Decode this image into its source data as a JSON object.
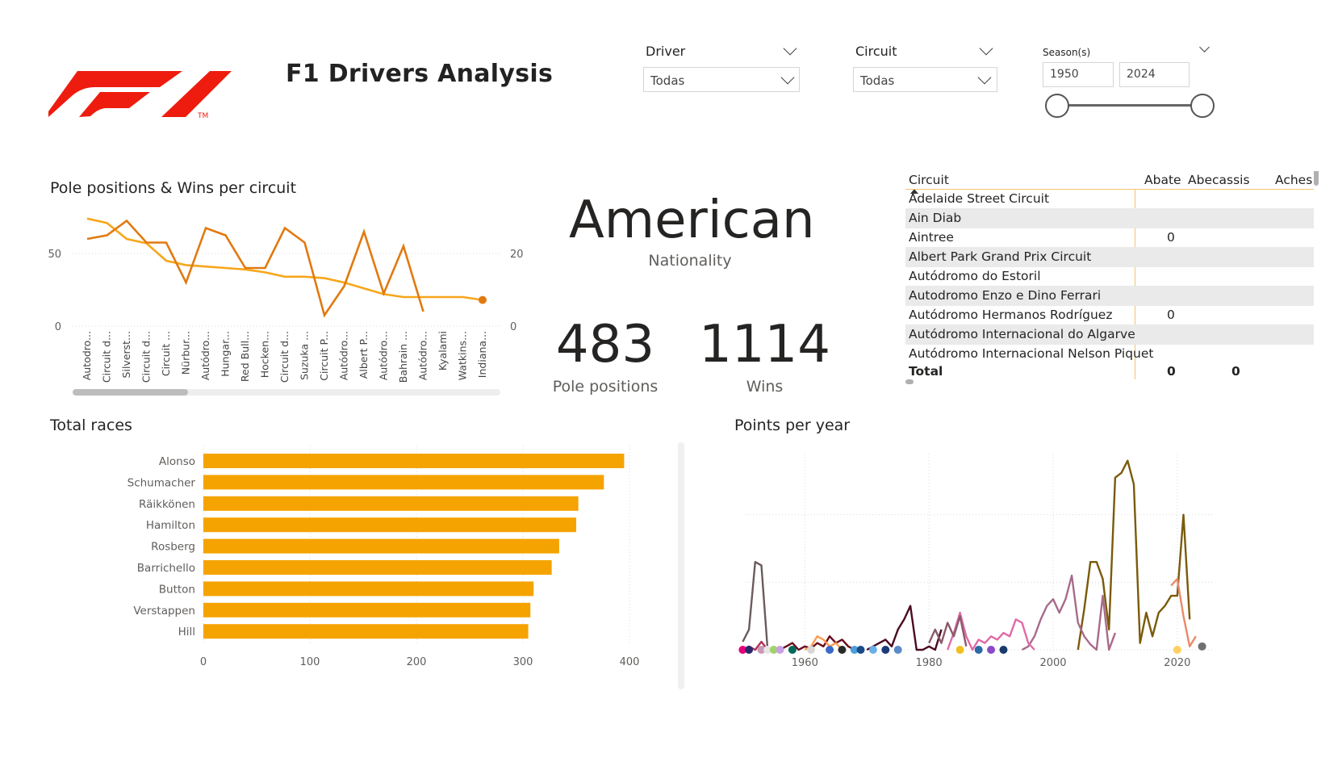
{
  "header": {
    "title": "F1 Drivers Analysis",
    "logo_mark": "F1",
    "logo_tm": "TM"
  },
  "slicers": {
    "driver": {
      "label": "Driver",
      "value": "Todas"
    },
    "circuit": {
      "label": "Circuit",
      "value": "Todas"
    },
    "season": {
      "label": "Season(s)",
      "from": "1950",
      "to": "2024",
      "range_fraction": [
        0,
        1
      ]
    }
  },
  "kpis": {
    "nationality": {
      "value": "American",
      "label": "Nationality"
    },
    "poles": {
      "value": "483",
      "label": "Pole positions"
    },
    "wins": {
      "value": "1114",
      "label": "Wins"
    }
  },
  "matrix": {
    "headers": [
      "Circuit",
      "Abate",
      "Abecassis",
      "Aches"
    ],
    "rows": [
      {
        "circuit": "Adelaide Street Circuit",
        "abate": "",
        "abecassis": ""
      },
      {
        "circuit": "Ain Diab",
        "abate": "",
        "abecassis": ""
      },
      {
        "circuit": "Aintree",
        "abate": "0",
        "abecassis": ""
      },
      {
        "circuit": "Albert Park Grand Prix Circuit",
        "abate": "",
        "abecassis": ""
      },
      {
        "circuit": "Autódromo do Estoril",
        "abate": "",
        "abecassis": ""
      },
      {
        "circuit": "Autodromo Enzo e Dino Ferrari",
        "abate": "",
        "abecassis": ""
      },
      {
        "circuit": "Autódromo Hermanos Rodríguez",
        "abate": "0",
        "abecassis": ""
      },
      {
        "circuit": "Autódromo Internacional do Algarve",
        "abate": "",
        "abecassis": ""
      },
      {
        "circuit": "Autódromo Internacional Nelson Piquet",
        "abate": "",
        "abecassis": ""
      }
    ],
    "total": {
      "label": "Total",
      "abate": "0",
      "abecassis": "0"
    }
  },
  "colors": {
    "accent": "#f5a300",
    "line_dark": "#e07a10",
    "line_light": "#f7a61a",
    "logo": "#ee1c0e",
    "grid": "#d9d9d9"
  },
  "chart_data": [
    {
      "type": "line",
      "title": "Pole positions & Wins per circuit",
      "categories": [
        "Autodro...",
        "Circuit d...",
        "Silverst...",
        "Circuit d...",
        "Circuit ...",
        "Nürbur...",
        "Autódro...",
        "Hungar...",
        "Red Bull...",
        "Hocken...",
        "Circuit d...",
        "Suzuka ...",
        "Circuit P...",
        "Autódro...",
        "Albert P...",
        "Autódro...",
        "Bahrain ...",
        "Autódro...",
        "Kyalami",
        "Watkins...",
        "Indiana..."
      ],
      "y_left": {
        "ticks": [
          "0",
          "50"
        ],
        "range": [
          0,
          100
        ]
      },
      "y_right": {
        "ticks": [
          "0",
          "20"
        ],
        "range": [
          0,
          42
        ]
      },
      "series": [
        {
          "axis": "left",
          "values": [
            74,
            71,
            60,
            57,
            45,
            42,
            41,
            40,
            39,
            37,
            34,
            34,
            33,
            30,
            26,
            22,
            20,
            20,
            20,
            20,
            18
          ]
        },
        {
          "axis": "right",
          "values": [
            24,
            25,
            29,
            23,
            23,
            12,
            27,
            25,
            16,
            16,
            27,
            23,
            3,
            11,
            26,
            9,
            22,
            4,
            null,
            null,
            null
          ]
        }
      ]
    },
    {
      "type": "bar",
      "title": "Total races",
      "categories": [
        "Alonso",
        "Schumacher",
        "Räikkönen",
        "Hamilton",
        "Rosberg",
        "Barrichello",
        "Button",
        "Verstappen",
        "Hill"
      ],
      "values": [
        395,
        376,
        352,
        350,
        334,
        327,
        310,
        307,
        305
      ],
      "x_ticks": [
        "0",
        "100",
        "200",
        "300",
        "400"
      ],
      "xlim": [
        0,
        400
      ]
    },
    {
      "type": "line",
      "title": "Points per year",
      "x_ticks": [
        "1960",
        "1980",
        "2000",
        "2020"
      ],
      "y_ticks": [
        "0",
        "100",
        "200",
        "300"
      ],
      "xlim": [
        1948,
        2026
      ],
      "ylim": [
        0,
        300
      ],
      "series": [
        {
          "color": "#6b5b5b",
          "x": [
            1950,
            1951,
            1952,
            1953,
            1954
          ],
          "y": [
            12,
            30,
            130,
            125,
            0
          ]
        },
        {
          "color": "#7a5a0a",
          "x": [
            2004,
            2005,
            2006,
            2007,
            2008,
            2009,
            2010,
            2011,
            2012,
            2013,
            2014,
            2015,
            2016,
            2017,
            2018,
            2019,
            2020,
            2021,
            2022,
            2023,
            2024
          ],
          "y": [
            0,
            60,
            130,
            130,
            105,
            30,
            255,
            262,
            280,
            245,
            10,
            55,
            20,
            55,
            65,
            80,
            80,
            200,
            45,
            null,
            null
          ]
        },
        {
          "color": "#a86a8a",
          "x": [
            1995,
            1996,
            1997,
            1998,
            1999,
            2000,
            2001,
            2002,
            2003,
            2004,
            2005,
            2006,
            2007,
            2008,
            2009,
            2010
          ],
          "y": [
            0,
            5,
            20,
            45,
            65,
            75,
            55,
            75,
            110,
            40,
            20,
            8,
            0,
            80,
            0,
            25
          ]
        },
        {
          "color": "#e06aa8",
          "x": [
            1983,
            1984,
            1985,
            1986,
            1987,
            1988,
            1989,
            1990,
            1991,
            1992,
            1993,
            1994,
            1995,
            1996,
            1997
          ],
          "y": [
            0,
            25,
            55,
            20,
            0,
            15,
            10,
            20,
            15,
            25,
            20,
            45,
            40,
            10,
            0
          ]
        },
        {
          "color": "#4a0a22",
          "x": [
            1970,
            1971,
            1972,
            1973,
            1974,
            1975,
            1976,
            1977,
            1978,
            1979,
            1980,
            1981,
            1982
          ],
          "y": [
            0,
            5,
            10,
            15,
            5,
            30,
            45,
            65,
            0,
            0,
            5,
            0,
            30
          ]
        },
        {
          "color": "#8a5a6a",
          "x": [
            1980,
            1981,
            1982,
            1983,
            1984,
            1985,
            1986
          ],
          "y": [
            10,
            30,
            10,
            40,
            20,
            50,
            5
          ]
        },
        {
          "color": "#6a0a1a",
          "x": [
            1956,
            1957,
            1958,
            1959,
            1960,
            1961,
            1962,
            1963,
            1964,
            1965,
            1966,
            1967,
            1968
          ],
          "y": [
            0,
            5,
            10,
            0,
            5,
            2,
            10,
            5,
            20,
            10,
            15,
            5,
            0
          ]
        },
        {
          "color": "#ff9a50",
          "x": [
            1960,
            1961,
            1962,
            1963,
            1964,
            1965,
            1966
          ],
          "y": [
            0,
            5,
            20,
            15,
            5,
            10,
            0
          ]
        },
        {
          "color": "#e88a6a",
          "x": [
            2019,
            2020,
            2021,
            2022,
            2023
          ],
          "y": [
            95,
            105,
            50,
            5,
            20
          ]
        },
        {
          "color": "#b0305a",
          "x": [
            1950,
            1951,
            1952,
            1953,
            1954,
            1955
          ],
          "y": [
            0,
            5,
            0,
            12,
            0,
            0
          ]
        }
      ],
      "points": [
        {
          "x": 1950,
          "y": 0,
          "color": "#e6007a"
        },
        {
          "x": 1951,
          "y": 0,
          "color": "#2a2a6a"
        },
        {
          "x": 1953,
          "y": 0,
          "color": "#c89ab6"
        },
        {
          "x": 1954,
          "y": 0,
          "color": "#e6e6e6"
        },
        {
          "x": 1955,
          "y": 0,
          "color": "#a0d468"
        },
        {
          "x": 1956,
          "y": 0,
          "color": "#c8a0e6"
        },
        {
          "x": 1958,
          "y": 0,
          "color": "#006a5a"
        },
        {
          "x": 1961,
          "y": 0,
          "color": "#d8d8d8"
        },
        {
          "x": 1964,
          "y": 0,
          "color": "#3a6ac8"
        },
        {
          "x": 1966,
          "y": 0,
          "color": "#2a2a2a"
        },
        {
          "x": 1968,
          "y": 0,
          "color": "#4aa0d8"
        },
        {
          "x": 1969,
          "y": 0,
          "color": "#1a4a8a"
        },
        {
          "x": 1971,
          "y": 0,
          "color": "#6ab0e6"
        },
        {
          "x": 1973,
          "y": 0,
          "color": "#1a3a7a"
        },
        {
          "x": 1975,
          "y": 0,
          "color": "#5a8ac8"
        },
        {
          "x": 1985,
          "y": 0,
          "color": "#f0c020"
        },
        {
          "x": 1988,
          "y": 0,
          "color": "#2a6aa8"
        },
        {
          "x": 1990,
          "y": 0,
          "color": "#8a4ac8"
        },
        {
          "x": 1992,
          "y": 0,
          "color": "#1a3a6a"
        },
        {
          "x": 2020,
          "y": 0,
          "color": "#ffd060"
        },
        {
          "x": 2024,
          "y": 5,
          "color": "#707070"
        }
      ]
    }
  ]
}
